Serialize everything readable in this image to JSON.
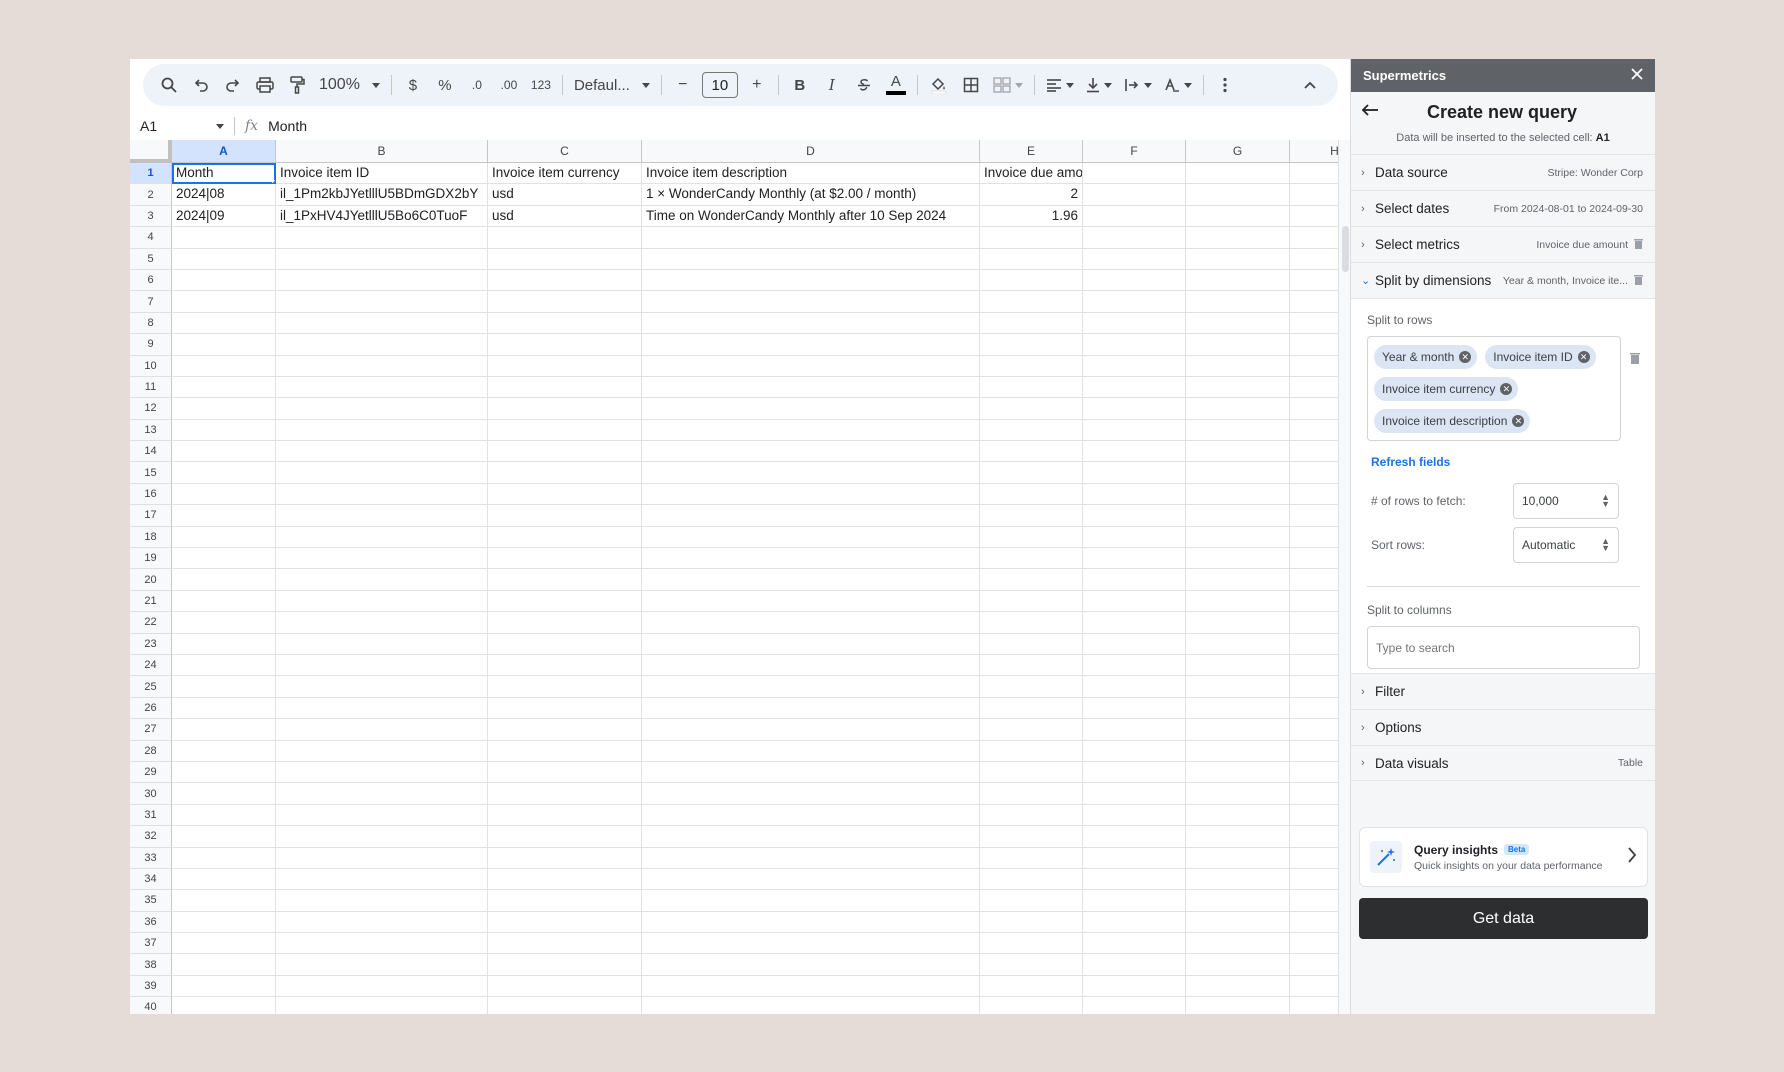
{
  "toolbar": {
    "zoom": "100%",
    "currency": "$",
    "percent": "%",
    "decimal_decrease": ".0",
    "decimal_increase": ".00",
    "number_format": "123",
    "font": "Defaul...",
    "font_size": "10",
    "minus": "−",
    "plus": "+",
    "bold": "B",
    "italic": "I",
    "text_color_letter": "A"
  },
  "formula_bar": {
    "cell_ref": "A1",
    "fx": "fx",
    "value": "Month"
  },
  "columns": [
    {
      "label": "A",
      "selected": true
    },
    {
      "label": "B"
    },
    {
      "label": "C"
    },
    {
      "label": "D"
    },
    {
      "label": "E"
    },
    {
      "label": "F"
    },
    {
      "label": "G"
    },
    {
      "label": "H"
    }
  ],
  "row_numbers": [
    "1",
    "2",
    "3",
    "4",
    "5",
    "6",
    "7",
    "8",
    "9",
    "10",
    "11",
    "12",
    "13",
    "14",
    "15",
    "16",
    "17",
    "18",
    "19",
    "20",
    "21",
    "22",
    "23",
    "24",
    "25",
    "26",
    "27",
    "28",
    "29",
    "30",
    "31",
    "32",
    "33",
    "34",
    "35",
    "36",
    "37",
    "38",
    "39",
    "40"
  ],
  "table": {
    "rows": [
      [
        "Month",
        "Invoice item ID",
        "Invoice item currency",
        "Invoice item description",
        "Invoice due amount"
      ],
      [
        "2024|08",
        "il_1Pm2kbJYetlllU5BDmGDX2bY",
        "usd",
        "1 × WonderCandy Monthly (at $2.00 / month)",
        "2"
      ],
      [
        "2024|09",
        "il_1PxHV4JYetlllU5Bo6C0TuoF",
        "usd",
        "Time on WonderCandy Monthly after 10 Sep 2024",
        "1.96"
      ]
    ]
  },
  "panel": {
    "app_name": "Supermetrics",
    "title": "Create new query",
    "subtitle_prefix": "Data will be inserted to the selected cell:",
    "subtitle_cell": "A1",
    "sections": {
      "data_source": {
        "label": "Data source",
        "summary": "Stripe: Wonder Corp"
      },
      "select_dates": {
        "label": "Select dates",
        "summary": "From 2024-08-01 to 2024-09-30"
      },
      "select_metrics": {
        "label": "Select metrics",
        "summary": "Invoice due amount"
      },
      "split_dimensions": {
        "label": "Split by dimensions",
        "summary": "Year & month, Invoice ite..."
      },
      "filter": {
        "label": "Filter"
      },
      "options": {
        "label": "Options"
      },
      "data_visuals": {
        "label": "Data visuals",
        "summary": "Table"
      }
    },
    "split_rows_label": "Split to rows",
    "chips": [
      "Year & month",
      "Invoice item ID",
      "Invoice item currency",
      "Invoice item description"
    ],
    "refresh_label": "Refresh fields",
    "rows_fetch_label": "# of rows to fetch:",
    "rows_fetch_value": "10,000",
    "sort_label": "Sort rows:",
    "sort_value": "Automatic",
    "split_cols_label": "Split to columns",
    "search_placeholder": "Type to search",
    "insights_title": "Query insights",
    "insights_badge": "Beta",
    "insights_sub": "Quick insights on your data performance",
    "get_data": "Get data"
  }
}
